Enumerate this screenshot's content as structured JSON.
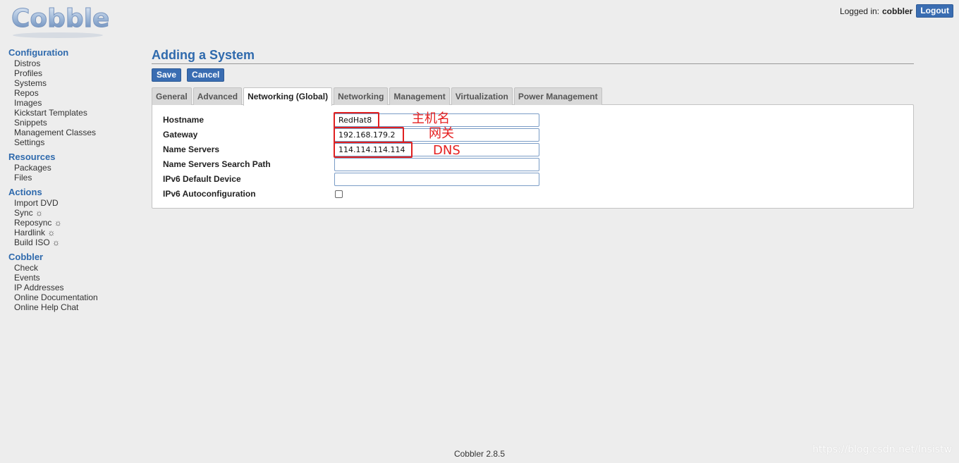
{
  "brand": {
    "logo_text": "Cobbler"
  },
  "header": {
    "logged_in_label": "Logged in:",
    "username": "cobbler",
    "logout_label": "Logout"
  },
  "sidebar": {
    "sections": [
      {
        "title": "Configuration",
        "items": [
          "Distros",
          "Profiles",
          "Systems",
          "Repos",
          "Images",
          "Kickstart Templates",
          "Snippets",
          "Management Classes",
          "Settings"
        ]
      },
      {
        "title": "Resources",
        "items": [
          "Packages",
          "Files"
        ]
      },
      {
        "title": "Actions",
        "items": [
          "Import DVD",
          "Sync ☼",
          "Reposync ☼",
          "Hardlink ☼",
          "Build ISO ☼"
        ]
      },
      {
        "title": "Cobbler",
        "items": [
          "Check",
          "Events",
          "IP Addresses",
          "Online Documentation",
          "Online Help Chat"
        ]
      }
    ]
  },
  "main": {
    "title": "Adding a System",
    "save_label": "Save",
    "cancel_label": "Cancel",
    "tabs": [
      "General",
      "Advanced",
      "Networking (Global)",
      "Networking",
      "Management",
      "Virtualization",
      "Power Management"
    ],
    "active_tab": "Networking (Global)",
    "fields": {
      "hostname": {
        "label": "Hostname",
        "value": "RedHat8",
        "annotation": "主机名"
      },
      "gateway": {
        "label": "Gateway",
        "value": "192.168.179.2",
        "annotation": "网关"
      },
      "name_servers": {
        "label": "Name Servers",
        "value": "114.114.114.114",
        "annotation": "DNS"
      },
      "search_path": {
        "label": "Name Servers Search Path",
        "value": ""
      },
      "ipv6_device": {
        "label": "IPv6 Default Device",
        "value": ""
      },
      "ipv6_autoconf": {
        "label": "IPv6 Autoconfiguration",
        "checked": false
      }
    }
  },
  "footer": {
    "version": "Cobbler 2.8.5"
  },
  "watermark": "https://blog.csdn.net/lnsistw",
  "colors": {
    "accent": "#3a6db2",
    "heading": "#2f6aad",
    "annotation": "#e52020",
    "background": "#ededed"
  }
}
